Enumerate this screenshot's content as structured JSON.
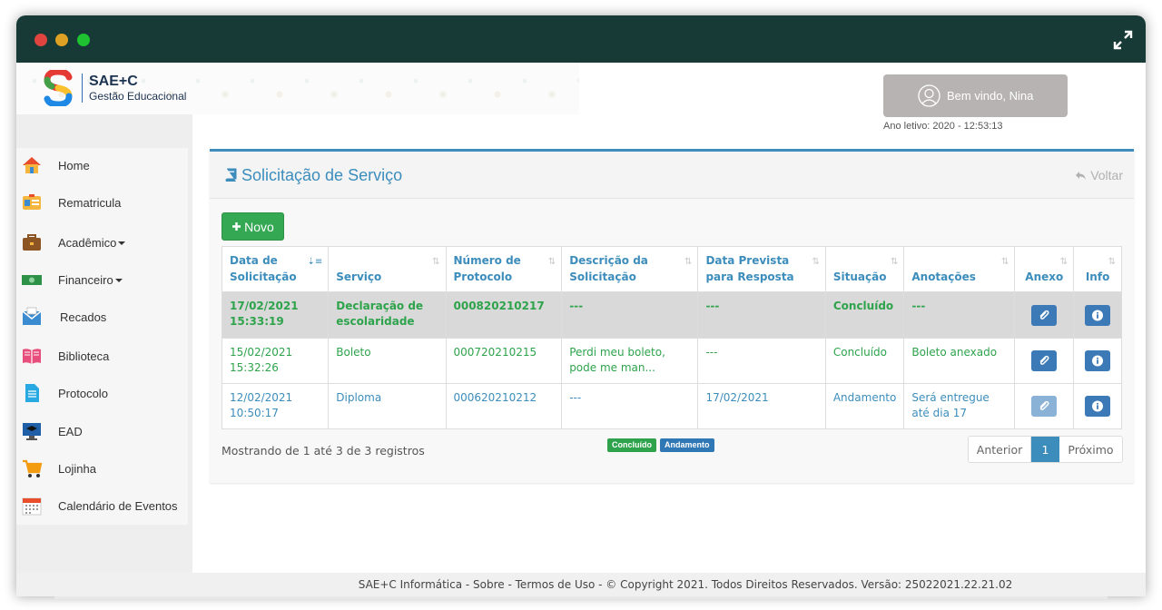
{
  "brand": {
    "name": "SAE+C",
    "sub": "Gestão Educacional"
  },
  "header": {
    "welcome": "Bem vindo, Nina",
    "ano": "Ano letivo: 2020 - 12:53:13"
  },
  "sidebar": {
    "items": [
      {
        "label": "Home",
        "icon": "home-icon"
      },
      {
        "label": "Rematricula",
        "icon": "id-card-icon"
      },
      {
        "label": "Acadêmico",
        "icon": "briefcase-icon",
        "dropdown": true
      },
      {
        "label": "Financeiro",
        "icon": "money-icon",
        "dropdown": true
      },
      {
        "label": "Recados",
        "icon": "mail-icon"
      },
      {
        "label": "Biblioteca",
        "icon": "book-icon"
      },
      {
        "label": "Protocolo",
        "icon": "document-icon"
      },
      {
        "label": "EAD",
        "icon": "graduation-monitor-icon"
      },
      {
        "label": "Lojinha",
        "icon": "cart-icon"
      },
      {
        "label": "Calendário de Eventos",
        "icon": "calendar-icon"
      }
    ]
  },
  "panel": {
    "title": "Solicitação de Serviço",
    "back": "Voltar"
  },
  "actions": {
    "new_label": "Novo"
  },
  "table": {
    "headers": [
      "Data de Solicitação",
      "Serviço",
      "Número de Protocolo",
      "Descrição da Solicitação",
      "Data Prevista para Resposta",
      "Situação",
      "Anotações",
      "Anexo",
      "Info"
    ],
    "rows": [
      {
        "data": "17/02/2021 15:33:19",
        "servico": "Declaração de escolaridade",
        "protocolo": "000820210217",
        "descricao": "---",
        "prevista": "---",
        "situacao": "Concluído",
        "anotacoes": "---"
      },
      {
        "data": "15/02/2021 15:32:26",
        "servico": "Boleto",
        "protocolo": "000720210215",
        "descricao": "Perdi meu boleto, pode me man...",
        "prevista": "---",
        "situacao": "Concluído",
        "anotacoes": "Boleto anexado"
      },
      {
        "data": "12/02/2021 10:50:17",
        "servico": "Diploma",
        "protocolo": "000620210212",
        "descricao": "---",
        "prevista": "17/02/2021",
        "situacao": "Andamento",
        "anotacoes": "Será entregue até dia 17"
      }
    ]
  },
  "status_legend": {
    "done": "Concluído",
    "progress": "Andamento"
  },
  "pagination": {
    "info": "Mostrando de 1 até 3 de 3 registros",
    "prev": "Anterior",
    "current": "1",
    "next": "Próximo"
  },
  "footer": {
    "text": "SAE+C Informática - Sobre - Termos de Uso - © Copyright 2021. Todos Direitos Reservados. Versão: 25022021.22.21.02"
  },
  "colors": {
    "accent": "#3c8dbc",
    "success": "#2ea34c",
    "titlebar": "#173a36"
  }
}
